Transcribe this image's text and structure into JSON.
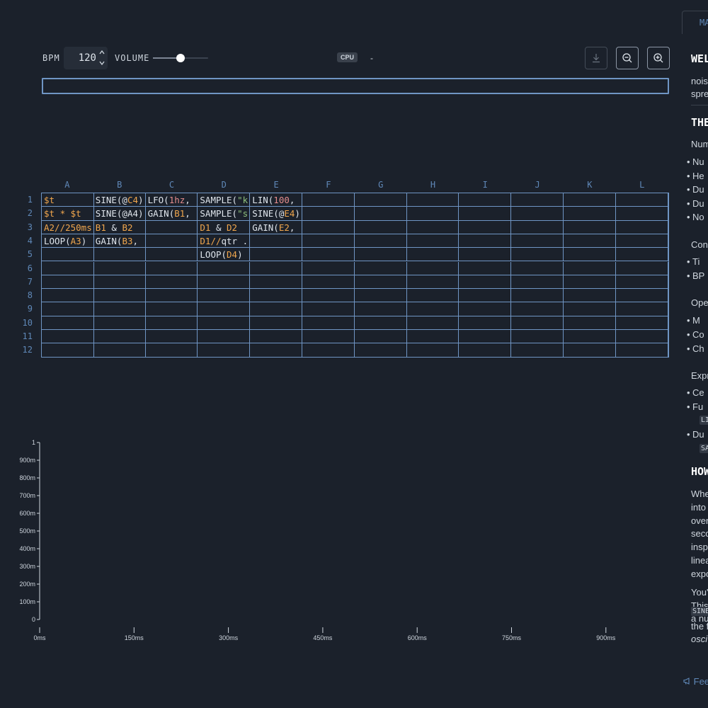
{
  "toolbar": {
    "bpm_label": "BPM",
    "bpm_value": "120",
    "volume_label": "VOLUME",
    "volume_level": 0.5,
    "cpu_label": "CPU",
    "cpu_value": "-",
    "icons": [
      "download-icon",
      "zoom-out-icon",
      "zoom-in-icon"
    ]
  },
  "formula_bar": {
    "value": ""
  },
  "grid": {
    "columns": [
      "A",
      "B",
      "C",
      "D",
      "E",
      "F",
      "G",
      "H",
      "I",
      "J",
      "K",
      "L"
    ],
    "rows": [
      "1",
      "2",
      "3",
      "4",
      "5",
      "6",
      "7",
      "8",
      "9",
      "10",
      "11",
      "12"
    ],
    "cells": {
      "A1": [
        [
          "$t",
          "ref"
        ]
      ],
      "A2": [
        [
          "$t * $t",
          "ref"
        ]
      ],
      "A3": [
        [
          "A2//250ms",
          "ref"
        ]
      ],
      "A4": [
        [
          "LOOP(",
          "plain"
        ],
        [
          "A3",
          "ref"
        ],
        [
          ")",
          "plain"
        ]
      ],
      "B1": [
        [
          "SINE(@",
          "plain"
        ],
        [
          "C4",
          "ref"
        ],
        [
          ")",
          "plain"
        ]
      ],
      "B2": [
        [
          "SINE(@A4)",
          "plain"
        ]
      ],
      "B3": [
        [
          "B1",
          "ref"
        ],
        [
          " & ",
          "plain"
        ],
        [
          "B2",
          "ref"
        ]
      ],
      "B4": [
        [
          "GAIN(",
          "plain"
        ],
        [
          "B3",
          "ref"
        ],
        [
          ",",
          "plain"
        ]
      ],
      "C1": [
        [
          "LFO(",
          "plain"
        ],
        [
          "1hz",
          "num"
        ],
        [
          ",",
          "plain"
        ]
      ],
      "C2": [
        [
          "GAIN(",
          "plain"
        ],
        [
          "B1",
          "ref"
        ],
        [
          ",",
          "plain"
        ]
      ],
      "D1": [
        [
          "SAMPLE(",
          "plain"
        ],
        [
          "\"k",
          "str"
        ]
      ],
      "D2": [
        [
          "SAMPLE(",
          "plain"
        ],
        [
          "\"s",
          "str"
        ]
      ],
      "D3": [
        [
          "D1",
          "ref"
        ],
        [
          " & ",
          "plain"
        ],
        [
          "D2",
          "ref"
        ]
      ],
      "D4": [
        [
          "D1//",
          "ref"
        ],
        [
          "qtr .",
          "plain"
        ]
      ],
      "D5": [
        [
          "LOOP(",
          "plain"
        ],
        [
          "D4",
          "ref"
        ],
        [
          ")",
          "plain"
        ]
      ],
      "E1": [
        [
          "LIN(",
          "plain"
        ],
        [
          "100",
          "num"
        ],
        [
          ",",
          "plain"
        ]
      ],
      "E2": [
        [
          "SINE(@",
          "plain"
        ],
        [
          "E4",
          "ref"
        ],
        [
          ")",
          "plain"
        ]
      ],
      "E3": [
        [
          "GAIN(",
          "plain"
        ],
        [
          "E2",
          "ref"
        ],
        [
          ",",
          "plain"
        ]
      ]
    }
  },
  "timeline": {
    "y_ticks": [
      "0",
      "100m",
      "200m",
      "300m",
      "400m",
      "500m",
      "600m",
      "700m",
      "800m",
      "900m",
      "1"
    ],
    "x_ticks": [
      "0ms",
      "150ms",
      "300ms",
      "450ms",
      "600ms",
      "750ms",
      "900ms"
    ]
  },
  "side": {
    "tab": "MA",
    "h_welcome": "WEL",
    "p1": "nois",
    "p2": "spre",
    "h_the": "THE",
    "num_label": "Num",
    "num_items": [
      "Nu",
      "He",
      "Du",
      "Du",
      "No"
    ],
    "con_label": "Con",
    "con_items": [
      "Ti",
      "BP"
    ],
    "ope_label": "Ope",
    "ope_items": [
      "M",
      "Co",
      "Ch"
    ],
    "expr_label": "Expr",
    "expr_items": [
      "Ce",
      "Fu",
      "Du"
    ],
    "code_fu": "LI",
    "code_du": "SA",
    "h_how": "HOW",
    "how_lines": [
      "Whe",
      "into",
      "over",
      "seco",
      "insp",
      "linea",
      "expo"
    ],
    "you_lines": [
      "You'",
      "This",
      "a nu"
    ],
    "code_sine": "SINE",
    "tail1": "the f",
    "tail2": "osci",
    "feedback": "Fee"
  }
}
